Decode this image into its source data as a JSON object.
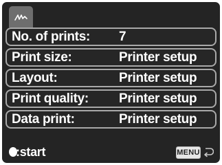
{
  "tabs": [
    {
      "icon": "signature-scribble-icon",
      "active": true
    }
  ],
  "menu": {
    "items": [
      {
        "label": "No. of prints:",
        "value": "7"
      },
      {
        "label": "Print size:",
        "value": "Printer setup"
      },
      {
        "label": "Layout:",
        "value": "Printer setup"
      },
      {
        "label": "Print quality:",
        "value": "Printer setup"
      },
      {
        "label": "Data print:",
        "value": "Printer setup"
      }
    ]
  },
  "footer": {
    "start_label": ":start",
    "menu_key_label": "MENU",
    "back_icon": "return-arrow-icon"
  },
  "colors": {
    "screen_bg": "#242424",
    "tab_active": "#6e6e6e",
    "row_border": "#a9a9a9",
    "text": "#ffffff"
  }
}
